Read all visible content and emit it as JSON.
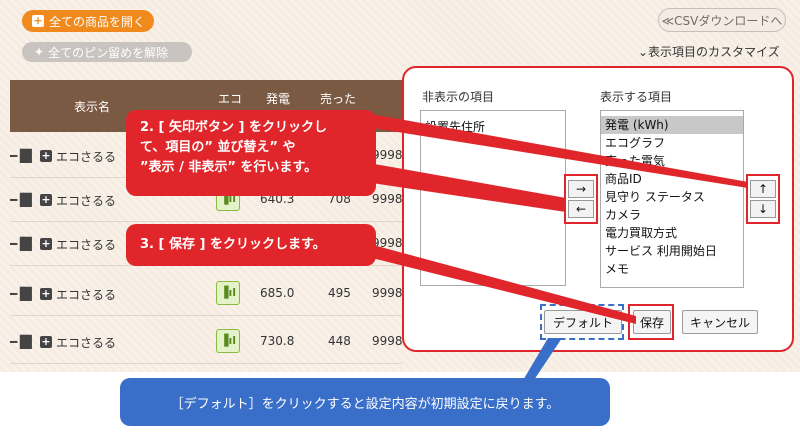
{
  "toolbar": {
    "open_all_label": "全ての商品を開く",
    "unpin_all_label": "全てのピン留めを解除",
    "csv_label": "≪CSVダウンロードへ",
    "customize_label": "⌄表示項目のカスタマイズ"
  },
  "table": {
    "headers": {
      "name": "表示名",
      "eco": "エコ",
      "gen": "発電",
      "sold": "売った"
    },
    "rows": [
      {
        "name": "エコさるる",
        "gen": "",
        "sold": "",
        "cut": "9998"
      },
      {
        "name": "エコさるる",
        "gen": "640.3",
        "sold": "708",
        "cut": "9998"
      },
      {
        "name": "エコさるる",
        "gen": "",
        "sold": "",
        "cut": "9998"
      },
      {
        "name": "エコさるる",
        "gen": "685.0",
        "sold": "495",
        "cut": "9998"
      },
      {
        "name": "エコさるる",
        "gen": "730.8",
        "sold": "448",
        "cut": "9998"
      }
    ]
  },
  "modal": {
    "hidden_label": "非表示の項目",
    "shown_label": "表示する項目",
    "hidden_items": [
      "設置先住所"
    ],
    "shown_items": [
      "発電 (kWh)",
      "エコグラフ",
      "売った電気",
      "商品ID",
      "見守り ステータス",
      "カメラ",
      "電力買取方式",
      "サービス 利用開始日",
      "メモ"
    ],
    "move_right": "→",
    "move_left": "←",
    "move_up": "↑",
    "move_down": "↓",
    "default_label": "デフォルト",
    "save_label": "保存",
    "cancel_label": "キャンセル"
  },
  "annotations": {
    "step2_line1": "2. [ 矢印ボタン ] をクリックし",
    "step2_line2": "て、項目の” 並び替え” や",
    "step2_line3": "”表示 / 非表示” を行います。",
    "step3": "3. [ 保存 ] をクリックします。",
    "note": "［デフォルト］をクリックすると設定内容が初期設定に戻ります。"
  },
  "colors": {
    "accent_orange": "#f08a1c",
    "header_brown": "#7b5a43",
    "annotation_red": "#e0262a",
    "note_blue": "#3a6fc9"
  }
}
